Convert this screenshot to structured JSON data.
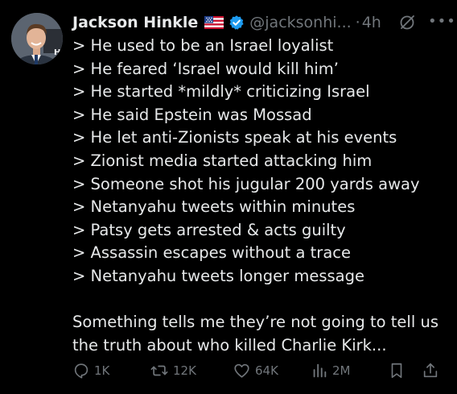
{
  "author": {
    "name": "Jackson Hinkle",
    "handle": "@jacksonhi...",
    "separator": "·",
    "time": "4h",
    "flag_icon": "us-flag-icon",
    "verified_icon": "verified-badge-icon"
  },
  "tweet": {
    "lines": [
      "> He used to be an Israel loyalist",
      "> He feared ‘Israel would kill him’",
      "> He started *mildly* criticizing Israel",
      "> He said Epstein was Mossad",
      "> He let anti-Zionists speak at his events",
      "> Zionist media started attacking him",
      "> Someone shot his jugular 200 yards away",
      "> Netanyahu tweets within minutes",
      "> Patsy gets arrested & acts guilty",
      "> Assassin escapes without a trace",
      "> Netanyahu tweets longer message"
    ],
    "closing": [
      "Something tells me they’re not going to tell us",
      "the truth about who killed Charlie Kirk..."
    ]
  },
  "actions": {
    "replies": "1K",
    "reposts": "12K",
    "likes": "64K",
    "views": "2M"
  },
  "colors": {
    "background": "#000000",
    "text": "#e7e9ea",
    "muted": "#71767b",
    "verified": "#1d9bf0"
  }
}
